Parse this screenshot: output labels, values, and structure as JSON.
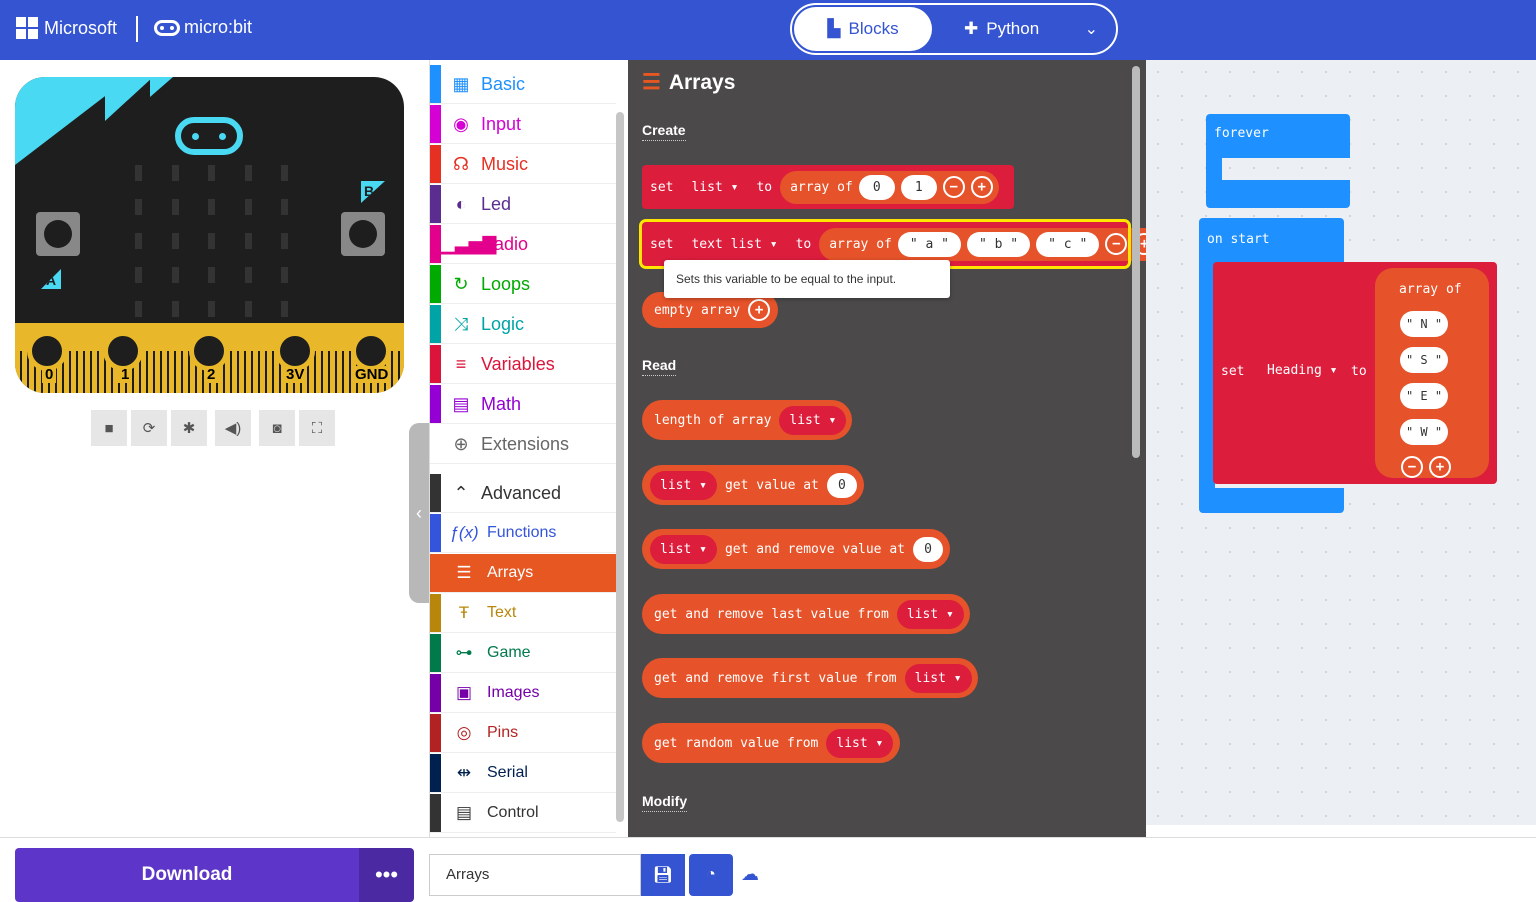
{
  "header": {
    "brand": "Microsoft",
    "product": "micro:bit",
    "modes": {
      "blocks": "Blocks",
      "python": "Python"
    }
  },
  "simulator": {
    "pins": [
      "0",
      "1",
      "2",
      "3V",
      "GND"
    ],
    "button_a": "A",
    "button_b": "B",
    "tools": [
      "stop-icon",
      "restart-icon",
      "debug-icon",
      "sound-icon",
      "screenshot-icon",
      "fullscreen-icon"
    ]
  },
  "toolbox": {
    "items": [
      {
        "label": "Basic",
        "color": "#1e90ff",
        "icon": "grid-icon"
      },
      {
        "label": "Input",
        "color": "#d400d4",
        "icon": "circle-dot-icon"
      },
      {
        "label": "Music",
        "color": "#e63022",
        "icon": "headphones-icon"
      },
      {
        "label": "Led",
        "color": "#5c2d91",
        "icon": "toggle-icon"
      },
      {
        "label": "Radio",
        "color": "#e3008c",
        "icon": "signal-icon"
      },
      {
        "label": "Loops",
        "color": "#00aa00",
        "icon": "loop-icon"
      },
      {
        "label": "Logic",
        "color": "#00a4a6",
        "icon": "shuffle-icon"
      },
      {
        "label": "Variables",
        "color": "#dc143c",
        "icon": "lines-icon"
      },
      {
        "label": "Math",
        "color": "#9400d3",
        "icon": "calculator-icon"
      },
      {
        "label": "Extensions",
        "color": "#666666",
        "icon": "plus-circle-icon"
      }
    ],
    "advanced_label": "Advanced",
    "sub_items": [
      {
        "label": "Functions",
        "color": "#3455db",
        "icon": "function-icon"
      },
      {
        "label": "Arrays",
        "color": "#e65722",
        "icon": "list-icon"
      },
      {
        "label": "Text",
        "color": "#b8860b",
        "icon": "text-icon"
      },
      {
        "label": "Game",
        "color": "#007a4b",
        "icon": "gamepad-icon"
      },
      {
        "label": "Images",
        "color": "#7600a8",
        "icon": "image-icon"
      },
      {
        "label": "Pins",
        "color": "#b22222",
        "icon": "target-icon"
      },
      {
        "label": "Serial",
        "color": "#002050",
        "icon": "usb-icon"
      },
      {
        "label": "Control",
        "color": "#333333",
        "icon": "server-icon"
      }
    ]
  },
  "flyout": {
    "title": "Arrays",
    "sections": {
      "create": "Create",
      "read": "Read",
      "modify": "Modify"
    },
    "blocks": {
      "set1": {
        "set": "set",
        "var": "list ▾",
        "to": "to",
        "array_of": "array of",
        "vals": [
          "0",
          "1"
        ]
      },
      "set2": {
        "set": "set",
        "var": "text list ▾",
        "to": "to",
        "array_of": "array of",
        "vals": [
          "\" a \"",
          "\" b \"",
          "\" c \""
        ]
      },
      "tooltip": "Sets this variable to be equal to the input.",
      "empty_array": "empty array",
      "length": {
        "text": "length of array",
        "var": "list ▾"
      },
      "get_value": {
        "var": "list ▾",
        "text": "get value at",
        "val": "0"
      },
      "get_remove": {
        "var": "list ▾",
        "text": "get and remove value at",
        "val": "0"
      },
      "remove_last": {
        "text": "get and remove last value from",
        "var": "list ▾"
      },
      "remove_first": {
        "text": "get and remove first value from",
        "var": "list ▾"
      },
      "random": {
        "text": "get random value from",
        "var": "list ▾"
      }
    }
  },
  "workspace": {
    "forever": "forever",
    "on_start": "on start",
    "set": "set",
    "heading_var": "Heading ▾",
    "to": "to",
    "array_of": "array of",
    "strings": [
      "\" N \"",
      "\" S \"",
      "\" E \"",
      "\" W \""
    ]
  },
  "bottom": {
    "download": "Download",
    "more": "•••",
    "project_name": "Arrays"
  }
}
